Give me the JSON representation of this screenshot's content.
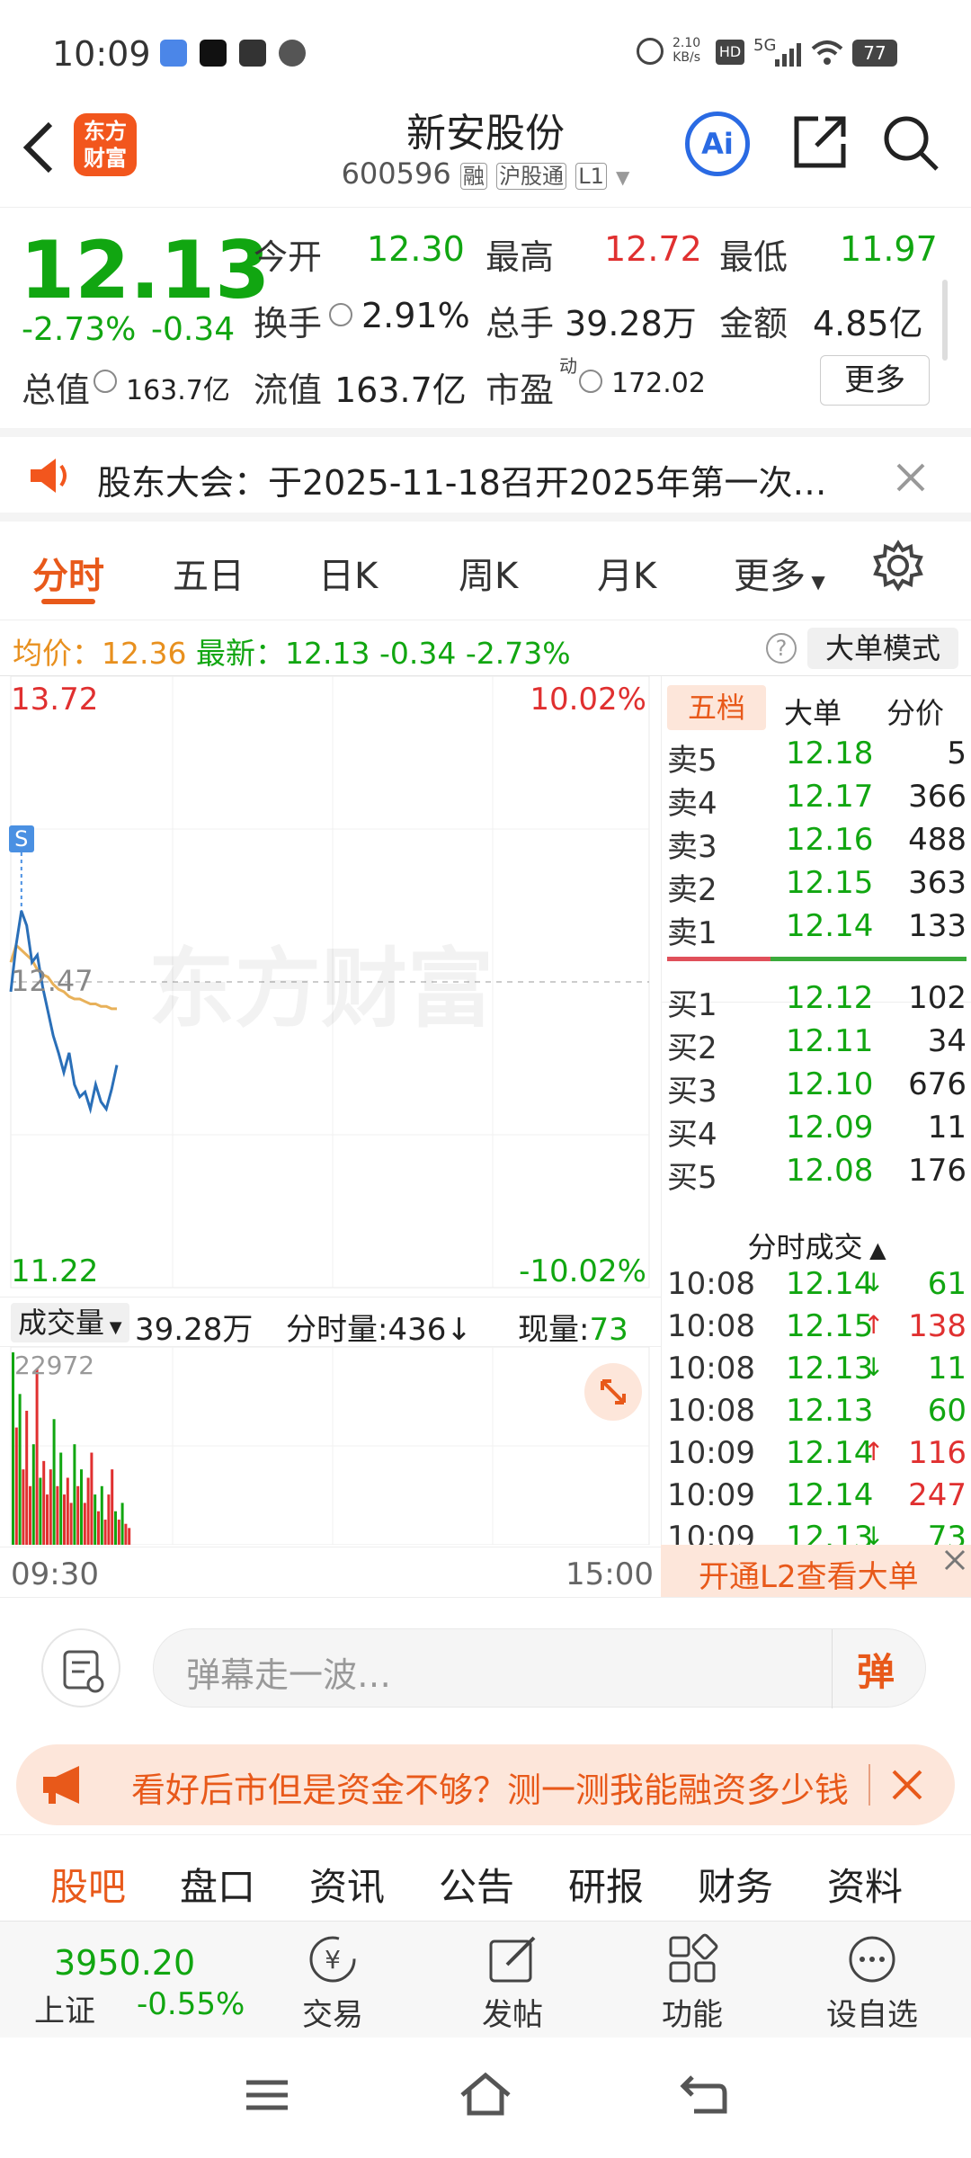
{
  "status": {
    "time": "10:09",
    "net_speed_top": "2.10",
    "net_speed_unit": "KB/s",
    "signal": "5G",
    "battery": "77"
  },
  "header": {
    "title": "新安股份",
    "code": "600596",
    "tags": [
      "融",
      "沪股通",
      "L1"
    ],
    "logo_text": "东方财富"
  },
  "quote": {
    "price": "12.13",
    "change_pct": "-2.73%",
    "change": "-0.34",
    "open_label": "今开",
    "open": "12.30",
    "high_label": "最高",
    "high": "12.72",
    "low_label": "最低",
    "low": "11.97",
    "turnover_label": "换手",
    "turnover": "2.91%",
    "volume_label": "总手",
    "volume": "39.28万",
    "amount_label": "金额",
    "amount": "4.85亿",
    "mktcap_label": "总值",
    "mktcap": "163.7亿",
    "float_label": "流值",
    "float": "163.7亿",
    "pe_label": "市盈",
    "pe_sup": "动",
    "pe": "172.02",
    "more": "更多"
  },
  "notice": {
    "text": "股东大会：于2025-11-18召开2025年第一次…"
  },
  "tabs": [
    "分时",
    "五日",
    "日K",
    "周K",
    "月K",
    "更多"
  ],
  "avg": {
    "avg_label": "均价：",
    "avg": "12.36",
    "latest_label": "最新：",
    "latest": "12.13",
    "chg": "-0.34",
    "pct": "-2.73%",
    "mode_btn": "大单模式"
  },
  "chart": {
    "top_price": "13.72",
    "top_pct": "10.02%",
    "mid_price": "12.47",
    "bottom_price": "11.22",
    "bottom_pct": "-10.02%",
    "watermark": "东方财富",
    "signal": "S"
  },
  "book": {
    "tabs": [
      "五档",
      "大单",
      "分价"
    ],
    "asks": [
      {
        "label": "卖5",
        "price": "12.18",
        "vol": "5"
      },
      {
        "label": "卖4",
        "price": "12.17",
        "vol": "366"
      },
      {
        "label": "卖3",
        "price": "12.16",
        "vol": "488"
      },
      {
        "label": "卖2",
        "price": "12.15",
        "vol": "363"
      },
      {
        "label": "卖1",
        "price": "12.14",
        "vol": "133"
      }
    ],
    "bids": [
      {
        "label": "买1",
        "price": "12.12",
        "vol": "102"
      },
      {
        "label": "买2",
        "price": "12.11",
        "vol": "34"
      },
      {
        "label": "买3",
        "price": "12.10",
        "vol": "676"
      },
      {
        "label": "买4",
        "price": "12.09",
        "vol": "11"
      },
      {
        "label": "买5",
        "price": "12.08",
        "vol": "176"
      }
    ],
    "ticks_title": "分时成交",
    "ticks": [
      {
        "time": "10:08",
        "price": "12.14",
        "dir": "↓",
        "vol": "61",
        "pc": "green",
        "vc": "green"
      },
      {
        "time": "10:08",
        "price": "12.15",
        "dir": "↑",
        "vol": "138",
        "pc": "green",
        "vc": "red"
      },
      {
        "time": "10:08",
        "price": "12.13",
        "dir": "↓",
        "vol": "11",
        "pc": "green",
        "vc": "green"
      },
      {
        "time": "10:08",
        "price": "12.13",
        "dir": "",
        "vol": "60",
        "pc": "green",
        "vc": "green"
      },
      {
        "time": "10:09",
        "price": "12.14",
        "dir": "↑",
        "vol": "116",
        "pc": "green",
        "vc": "red"
      },
      {
        "time": "10:09",
        "price": "12.14",
        "dir": "",
        "vol": "247",
        "pc": "green",
        "vc": "red"
      },
      {
        "time": "10:09",
        "price": "12.13",
        "dir": "↓",
        "vol": "73",
        "pc": "green",
        "vc": "green"
      }
    ],
    "l2_banner": "开通L2查看大单"
  },
  "volume": {
    "label": "成交量",
    "total": "39.28万",
    "per_min_label": "分时量:",
    "per_min": "436",
    "per_min_arrow": "↓",
    "now_label": "现量:",
    "now": "73",
    "max": "22972"
  },
  "time_axis": {
    "start": "09:30",
    "end": "15:00"
  },
  "danmu": {
    "placeholder": "弹幕走一波…",
    "send": "弹"
  },
  "promo": {
    "text": "看好后市但是资金不够？测一测我能融资多少钱"
  },
  "bar_tabs": [
    "股吧",
    "盘口",
    "资讯",
    "公告",
    "研报",
    "财务",
    "资料"
  ],
  "bottom_nav": {
    "index_value": "3950.20",
    "index_name": "上证",
    "index_pct": "-0.55%",
    "items": [
      "交易",
      "发帖",
      "功能",
      "设自选"
    ]
  },
  "colors": {
    "up": "#e03030",
    "down": "#11a611",
    "accent": "#e8591a",
    "avg": "#e8b15a",
    "line": "#2a6fb8"
  },
  "chart_data": {
    "type": "line",
    "x_range": [
      "09:30",
      "15:00"
    ],
    "ylim": [
      11.22,
      13.72
    ],
    "series": [
      {
        "values": [
          12.43,
          12.62,
          12.76,
          12.7,
          12.55,
          12.58,
          12.45,
          12.35,
          12.25,
          12.18,
          12.1,
          12.18,
          12.05,
          12.0,
          12.02,
          11.95,
          12.05,
          11.98,
          11.95,
          12.03,
          12.13
        ]
      },
      {
        "values": [
          12.55,
          12.62,
          12.6,
          12.58,
          12.56,
          12.52,
          12.5,
          12.49,
          12.46,
          12.44,
          12.43,
          12.41,
          12.4,
          12.4,
          12.39,
          12.38,
          12.38,
          12.37,
          12.37,
          12.36,
          12.36
        ]
      }
    ],
    "volume": [
      22972,
      14000,
      18000,
      9000,
      16000,
      7000,
      12000,
      21000,
      8000,
      10000,
      6000,
      9000,
      15000,
      7000,
      11000,
      6000,
      8000,
      5000,
      12000,
      7000,
      9000,
      5000,
      8000,
      11000,
      6000,
      4000,
      7000,
      3000,
      6000,
      9000,
      4000,
      3000,
      5000,
      2500,
      2000
    ]
  }
}
